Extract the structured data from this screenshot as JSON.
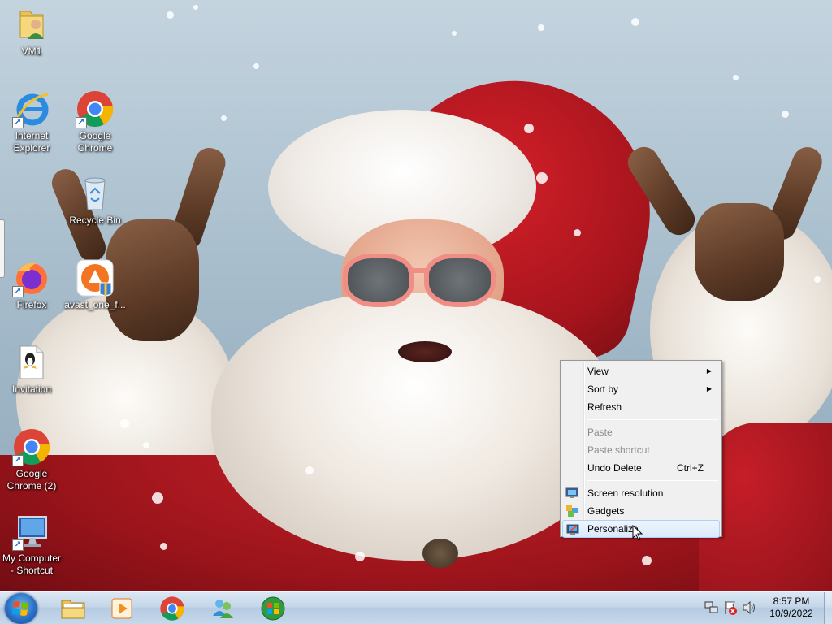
{
  "desktop": {
    "icons": [
      {
        "label": "VM1",
        "icon": "user-folder-icon"
      },
      {
        "label": "Internet\nExplorer",
        "icon": "internet-explorer-icon"
      },
      {
        "label": "Google\nChrome",
        "icon": "chrome-icon"
      },
      {
        "label": "Recycle Bin",
        "icon": "recycle-bin-icon"
      },
      {
        "label": "Firefox",
        "icon": "firefox-icon"
      },
      {
        "label": "avast_one_f...",
        "icon": "avast-installer-icon"
      },
      {
        "label": "Invitation",
        "icon": "document-icon"
      },
      {
        "label": "Google\nChrome (2)",
        "icon": "chrome-icon"
      },
      {
        "label": "My Computer\n- Shortcut",
        "icon": "computer-icon"
      }
    ]
  },
  "context_menu": {
    "items": [
      {
        "label": "View",
        "has_submenu": true
      },
      {
        "label": "Sort by",
        "has_submenu": true
      },
      {
        "label": "Refresh"
      },
      {
        "label": "Paste",
        "disabled": true
      },
      {
        "label": "Paste shortcut",
        "disabled": true
      },
      {
        "label": "Undo Delete",
        "shortcut": "Ctrl+Z"
      },
      {
        "label": "Screen resolution",
        "icon": "screen-resolution-icon"
      },
      {
        "label": "Gadgets",
        "icon": "gadgets-icon"
      },
      {
        "label": "Personalize",
        "icon": "personalize-icon",
        "highlighted": true
      }
    ]
  },
  "taskbar": {
    "pinned": [
      "windows-explorer-icon",
      "media-player-icon",
      "chrome-icon",
      "windows-live-messenger-icon",
      "windows-update-icon"
    ],
    "tray": [
      "network-icon",
      "action-center-icon",
      "volume-icon"
    ],
    "clock": {
      "time": "8:57 PM",
      "date": "10/9/2022"
    }
  },
  "colors": {
    "menu_bg": "#f0f0f0",
    "menu_highlight": "#dbeafb",
    "taskbar": "#c4d6e9"
  }
}
